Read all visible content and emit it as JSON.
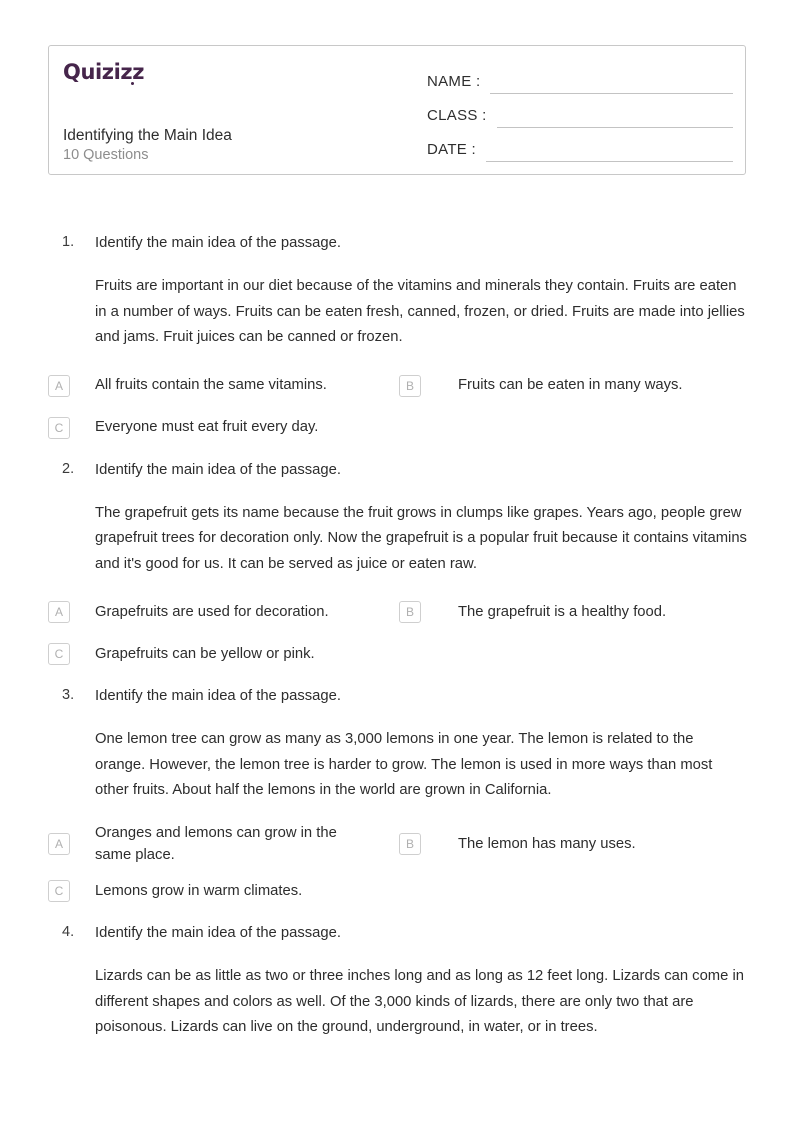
{
  "header": {
    "logo_text": "Quizizz",
    "quiz_title": "Identifying the Main Idea",
    "question_count_label": "10 Questions",
    "fields": [
      {
        "label": "NAME :"
      },
      {
        "label": "CLASS :"
      },
      {
        "label": "DATE  :"
      }
    ],
    "brand_color": "#46254b"
  },
  "questions": [
    {
      "number": "1.",
      "prompt": "Identify the main idea of the passage.",
      "passage": "Fruits are important in our diet because of the vitamins and minerals they contain. Fruits are eaten in a number of ways. Fruits can be eaten fresh, canned, frozen, or dried. Fruits are made into jellies and jams. Fruit juices can be canned or frozen.",
      "options": [
        {
          "letter": "A",
          "text": "All fruits contain the same vitamins."
        },
        {
          "letter": "B",
          "text": "Fruits can be eaten in many ways."
        },
        {
          "letter": "C",
          "text": "Everyone must eat fruit every day."
        }
      ]
    },
    {
      "number": "2.",
      "prompt": "Identify the main idea of the passage.",
      "passage": "The grapefruit gets its name because the fruit grows in clumps like grapes. Years ago, people grew grapefruit trees for decoration only. Now the grapefruit is a popular fruit because it contains vitamins and it's good for us. It can be served as juice or eaten raw.",
      "options": [
        {
          "letter": "A",
          "text": "Grapefruits are used for decoration."
        },
        {
          "letter": "B",
          "text": "The grapefruit is a healthy food."
        },
        {
          "letter": "C",
          "text": "Grapefruits can be yellow or pink."
        }
      ]
    },
    {
      "number": "3.",
      "prompt": "Identify the main idea of the passage.",
      "passage": "One lemon tree can grow as many as 3,000 lemons in one year. The lemon is related to the orange. However, the lemon tree is harder to grow. The lemon is used in more ways than most other fruits. About half the lemons in the world are grown in California.",
      "options": [
        {
          "letter": "A",
          "text": "Oranges and lemons can grow in the same place."
        },
        {
          "letter": "B",
          "text": "The lemon has many uses."
        },
        {
          "letter": "C",
          "text": "Lemons grow in warm climates."
        }
      ]
    },
    {
      "number": "4.",
      "prompt": "Identify the main idea of the passage.",
      "passage": "Lizards can be as little as two or three inches long and as long as 12 feet long. Lizards can come in different shapes and colors as well. Of the 3,000 kinds of lizards, there are only two that are poisonous. Lizards can live on the ground, underground, in water, or in trees.",
      "options": []
    }
  ]
}
